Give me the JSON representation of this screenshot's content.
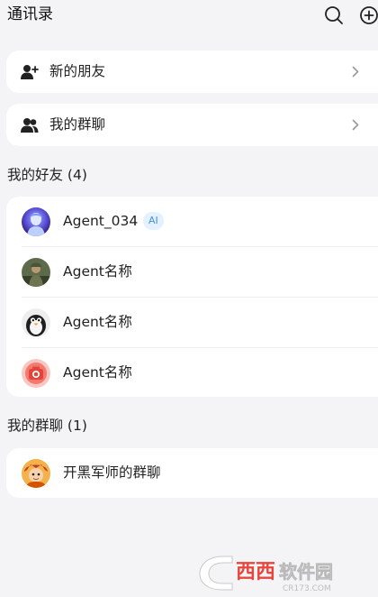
{
  "header": {
    "title": "通讯录",
    "search_icon": "search-icon",
    "add_icon": "add-circle-icon"
  },
  "nav": {
    "new_friends": {
      "label": "新的朋友",
      "icon": "add-user-icon"
    },
    "my_groups": {
      "label": "我的群聊",
      "icon": "people-icon"
    }
  },
  "friends": {
    "title": "我的好友 (4)",
    "items": [
      {
        "name": "Agent_034",
        "badge": "AI",
        "avatar": "blue-portrait-avatar"
      },
      {
        "name": "Agent名称",
        "avatar": "soldier-avatar"
      },
      {
        "name": "Agent名称",
        "avatar": "penguin-avatar"
      },
      {
        "name": "Agent名称",
        "avatar": "camera-avatar"
      }
    ]
  },
  "groups": {
    "title": "我的群聊 (1)",
    "items": [
      {
        "name": "开黑军师的群聊",
        "avatar": "game-hero-avatar"
      }
    ]
  },
  "watermark": {
    "text": "西西软件园",
    "url_text": "CR173.COM"
  },
  "colors": {
    "background": "#f4f4f6",
    "card": "#ffffff",
    "ai_badge_bg": "#e4f1ff",
    "ai_badge_text": "#4a90e2",
    "watermark_accent": "#e8453c"
  }
}
